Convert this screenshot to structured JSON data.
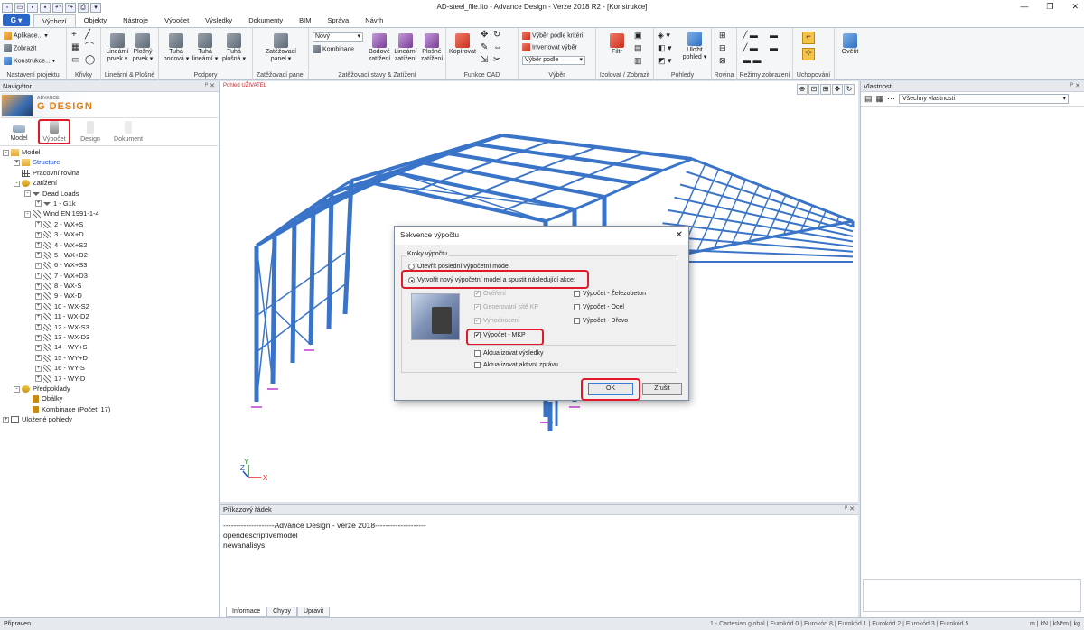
{
  "window": {
    "title": "AD-steel_file.fto - Advance Design - Verze 2018 R2 - [Konstrukce]",
    "app_button": "G"
  },
  "tabs": [
    "Výchozí",
    "Objekty",
    "Nástroje",
    "Výpočet",
    "Výsledky",
    "Dokumenty",
    "BIM",
    "Správa",
    "Návrh"
  ],
  "ribbon": {
    "project": {
      "items": [
        "Aplikace...",
        "Zobrazit",
        "Konstrukce..."
      ],
      "label": "Nastavení projektu"
    },
    "curves": {
      "label": "Křivky"
    },
    "linear": {
      "items": [
        "Lineární prvek",
        "Plošný prvek"
      ],
      "label": "Lineární & Plošné"
    },
    "supports": {
      "items": [
        "Tuhá bodová",
        "Tuhá lineární",
        "Tuhá plošná"
      ],
      "label": "Podpory"
    },
    "load_panel": {
      "items": [
        "Zatěžovací panel"
      ],
      "label": "Zatěžovací panel"
    },
    "loads": {
      "combo_value": "Nový",
      "combo_button": "Kombinace",
      "items": [
        "Bodové zatížení",
        "Lineární zatížení",
        "Plošné zatížení"
      ],
      "label": "Zatěžovací stavy & Zatížení"
    },
    "cad": {
      "items": [
        "Kopírovat"
      ],
      "label": "Funkce CAD"
    },
    "selection": {
      "items": [
        "Výběr podle kritérií",
        "Invertovat výběr"
      ],
      "combo": "Výběr podle",
      "label": "Výběr"
    },
    "isolate": {
      "items": [
        "Filtr"
      ],
      "label": "Izolovat / Zobrazit"
    },
    "views": {
      "items": [
        "Uložit pohled"
      ],
      "label": "Pohledy"
    },
    "plane": {
      "label": "Rovina"
    },
    "display": {
      "label": "Režimy zobrazení"
    },
    "snap": {
      "label": "Uchopování"
    },
    "verify": {
      "items": [
        "Ověřit"
      ]
    }
  },
  "navigator": {
    "title": "Navigátor",
    "logo_small": "ADVANCE",
    "logo": "DESIGN",
    "logo_prefix": "G",
    "tools": [
      "Model",
      "Výpočet",
      "Design",
      "Dokument"
    ],
    "tree": [
      {
        "label": "Model",
        "level": 0,
        "icon": "folder",
        "exp": "-"
      },
      {
        "label": "Structure",
        "level": 1,
        "icon": "folder",
        "exp": "+",
        "link": true
      },
      {
        "label": "Pracovní rovina",
        "level": 1,
        "icon": "grid",
        "exp": ""
      },
      {
        "label": "Zatížení",
        "level": 1,
        "icon": "load",
        "exp": "-"
      },
      {
        "label": "Dead Loads",
        "level": 2,
        "icon": "arrow",
        "exp": "-"
      },
      {
        "label": "1 - G1k",
        "level": 3,
        "icon": "arrow",
        "exp": "+"
      },
      {
        "label": "Wind EN 1991-1-4",
        "level": 2,
        "icon": "wind",
        "exp": "-"
      },
      {
        "label": "2 - WX+S",
        "level": 3,
        "icon": "wind",
        "exp": "+"
      },
      {
        "label": "3 - WX+D",
        "level": 3,
        "icon": "wind",
        "exp": "+"
      },
      {
        "label": "4 - WX+S2",
        "level": 3,
        "icon": "wind",
        "exp": "+"
      },
      {
        "label": "5 - WX+D2",
        "level": 3,
        "icon": "wind",
        "exp": "+"
      },
      {
        "label": "6 - WX+S3",
        "level": 3,
        "icon": "wind",
        "exp": "+"
      },
      {
        "label": "7 - WX+D3",
        "level": 3,
        "icon": "wind",
        "exp": "+"
      },
      {
        "label": "8 - WX-S",
        "level": 3,
        "icon": "wind",
        "exp": "+"
      },
      {
        "label": "9 - WX-D",
        "level": 3,
        "icon": "wind",
        "exp": "+"
      },
      {
        "label": "10 - WX-S2",
        "level": 3,
        "icon": "wind",
        "exp": "+"
      },
      {
        "label": "11 - WX-D2",
        "level": 3,
        "icon": "wind",
        "exp": "+"
      },
      {
        "label": "12 - WX-S3",
        "level": 3,
        "icon": "wind",
        "exp": "+"
      },
      {
        "label": "13 - WX-D3",
        "level": 3,
        "icon": "wind",
        "exp": "+"
      },
      {
        "label": "14 - WY+S",
        "level": 3,
        "icon": "wind",
        "exp": "+"
      },
      {
        "label": "15 - WY+D",
        "level": 3,
        "icon": "wind",
        "exp": "+"
      },
      {
        "label": "16 - WY-S",
        "level": 3,
        "icon": "wind",
        "exp": "+"
      },
      {
        "label": "17 - WY-D",
        "level": 3,
        "icon": "wind",
        "exp": "+"
      },
      {
        "label": "Předpoklady",
        "level": 1,
        "icon": "load",
        "exp": "-"
      },
      {
        "label": "Obálky",
        "level": 2,
        "icon": "leaf",
        "exp": ""
      },
      {
        "label": "Kombinace (Počet: 17)",
        "level": 2,
        "icon": "leaf",
        "exp": ""
      },
      {
        "label": "Uložené pohledy",
        "level": 0,
        "icon": "view",
        "exp": "+"
      }
    ]
  },
  "viewport": {
    "label": "Pohled UŽIVATEL",
    "axis_x": "X",
    "axis_y": "Y",
    "axis_z": "Z"
  },
  "dialog": {
    "title": "Sekvence výpočtu",
    "group": "Kroky výpočtu",
    "radio1": "Otevřít poslední výpočetní model",
    "radio2": "Vytvořit nový výpočetní model a spustit následující akce:",
    "checks_left": [
      {
        "label": "Ověření",
        "checked": true,
        "disabled": true
      },
      {
        "label": "Generování sítě KP",
        "checked": true,
        "disabled": true
      },
      {
        "label": "Vyhodnocení",
        "checked": true,
        "disabled": true
      },
      {
        "label": "Výpočet - MKP",
        "checked": true,
        "disabled": false
      }
    ],
    "checks_right": [
      {
        "label": "Výpočet - Železobeton",
        "checked": false
      },
      {
        "label": "Výpočet - Ocel",
        "checked": false
      },
      {
        "label": "Výpočet - Dřevo",
        "checked": false
      }
    ],
    "checks_bottom": [
      {
        "label": "Aktualizovat výsledky",
        "checked": false
      },
      {
        "label": "Aktualizovat aktivní zprávu",
        "checked": false
      }
    ],
    "ok": "OK",
    "cancel": "Zrušit"
  },
  "command": {
    "title": "Příkazový řádek",
    "lines": "--------------------Advance Design - verze 2018--------------------\nopendescriptivemodel\nnewanalisys",
    "tabs": [
      "Informace",
      "Chyby",
      "Upravit"
    ]
  },
  "properties": {
    "title": "Vlastnosti",
    "filter": "Všechny vlastnosti"
  },
  "status": {
    "left": "Připraven",
    "right": "1 - Cartesian global | Eurokód 0 | Eurokód 8 | Eurokód 1 | Eurokód 2 | Eurokód 3 | Eurokód 5",
    "units": "m | kN | kN*m | kg"
  },
  "colors": {
    "accent": "#2a66c8",
    "highlight": "#e0182a",
    "steel": "#3a74c8"
  }
}
